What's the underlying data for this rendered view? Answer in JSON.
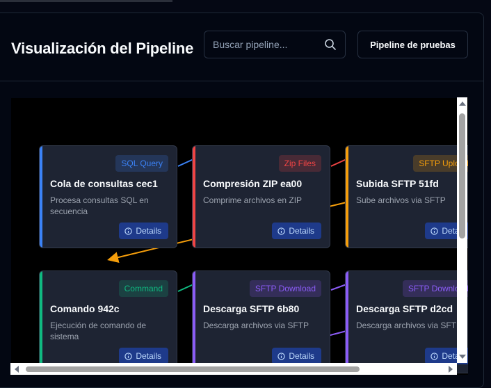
{
  "header": {
    "title": "Visualización del Pipeline",
    "search_placeholder": "Buscar pipeline...",
    "test_button_label": "Pipeline de pruebas"
  },
  "details_label": "Details",
  "nodes": [
    {
      "id": "n1",
      "badge": "SQL Query",
      "badge_color": "#3b82f6",
      "bar_color": "#3b82f6",
      "title": "Cola de consultas cec1",
      "description": "Procesa consultas SQL en secuencia"
    },
    {
      "id": "n2",
      "badge": "Zip Files",
      "badge_color": "#ef4444",
      "bar_color": "#ef4444",
      "title": "Compresión ZIP ea00",
      "description": "Comprime archivos en ZIP"
    },
    {
      "id": "n3",
      "badge": "SFTP Upload",
      "badge_color": "#f59e0b",
      "bar_color": "#f59e0b",
      "title": "Subida SFTP 51fd",
      "description": "Sube archivos via SFTP"
    },
    {
      "id": "n4",
      "badge": "Command",
      "badge_color": "#10b981",
      "bar_color": "#10b981",
      "title": "Comando 942c",
      "description": "Ejecución de comando de sistema"
    },
    {
      "id": "n5",
      "badge": "SFTP Download",
      "badge_color": "#8b5cf6",
      "bar_color": "#8b5cf6",
      "title": "Descarga SFTP 6b80",
      "description": "Descarga archivos via SFTP"
    },
    {
      "id": "n6",
      "badge": "SFTP Download",
      "badge_color": "#8b5cf6",
      "bar_color": "#8b5cf6",
      "title": "Descarga SFTP d2cd",
      "description": "Descarga archivos via SFTP"
    }
  ],
  "edge_colors": [
    "#3b82f6",
    "#ef4444",
    "#f59e0b",
    "#10b981",
    "#8b5cf6",
    "#8b5cf6"
  ]
}
